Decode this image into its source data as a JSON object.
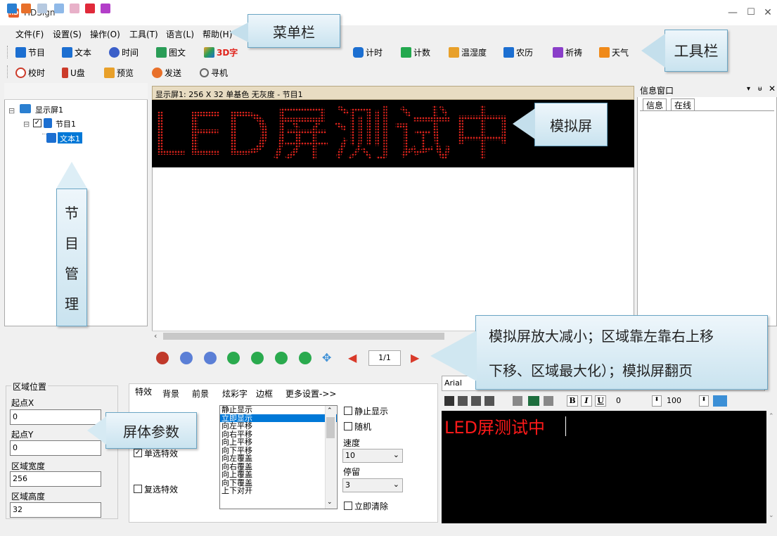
{
  "window": {
    "title": "HDSign",
    "logo_text": "HD"
  },
  "menu": [
    "文件(F)",
    "设置(S)",
    "操作(O)",
    "工具(T)",
    "语言(L)",
    "帮助(H)"
  ],
  "toolbar1": [
    {
      "label": "节目",
      "icon": "program-icon",
      "color": "#1c6fd1"
    },
    {
      "label": "文本",
      "icon": "text-icon",
      "color": "#1c6fd1"
    },
    {
      "label": "时间",
      "icon": "clock-icon",
      "color": "#3b5fc9"
    },
    {
      "label": "图文",
      "icon": "image-icon",
      "color": "#2a9d57"
    },
    {
      "label": "3D字",
      "icon": "cube-icon",
      "color": "#e8a02a"
    },
    {
      "label": "计时",
      "icon": "timer-icon",
      "color": "#1c6fd1"
    },
    {
      "label": "计数",
      "icon": "counter-icon",
      "color": "#23a84e"
    },
    {
      "label": "温湿度",
      "icon": "thermometer-icon",
      "color": "#e8a02a"
    },
    {
      "label": "农历",
      "icon": "calendar-icon",
      "color": "#1c6fd1"
    },
    {
      "label": "祈祷",
      "icon": "prayer-icon",
      "color": "#8a3ec9"
    },
    {
      "label": "天气",
      "icon": "weather-icon",
      "color": "#f08a1a"
    }
  ],
  "toolbar2": [
    {
      "label": "校时",
      "icon": "sync-time-icon",
      "color": "#cc3b2a"
    },
    {
      "label": "U盘",
      "icon": "usb-icon",
      "color": "#cc3b2a"
    },
    {
      "label": "预览",
      "icon": "preview-icon",
      "color": "#e8a02a"
    },
    {
      "label": "发送",
      "icon": "send-icon",
      "color": "#e8702a"
    },
    {
      "label": "寻机",
      "icon": "search-icon",
      "color": "#666"
    }
  ],
  "tree": {
    "screen": "显示屏1",
    "program": "节目1",
    "text": "文本1"
  },
  "screen_header": "显示屏1: 256 X 32  单基色 无灰度 - 节目1",
  "led_text": "LED屏测试中",
  "page_indicator": "1/1",
  "info_panel": {
    "title": "信息窗口",
    "tabs": [
      "信息",
      "在线"
    ]
  },
  "region": {
    "group_title": "区域位置",
    "x_label": "起点X",
    "x_value": "0",
    "y_label": "起点Y",
    "y_value": "0",
    "w_label": "区域宽度",
    "w_value": "256",
    "h_label": "区域高度",
    "h_value": "32"
  },
  "effect_tabs": [
    "特效",
    "背景",
    "前景",
    "炫彩字",
    "边框",
    "更多设置->>"
  ],
  "effect_options": {
    "single": "单选特效",
    "multi": "复选特效"
  },
  "effects": [
    "静止显示",
    "立即显示",
    "向左平移",
    "向右平移",
    "向上平移",
    "向下平移",
    "向左覆盖",
    "向右覆盖",
    "向上覆盖",
    "向下覆盖",
    "上下对开"
  ],
  "effect_selected": 1,
  "right_opts": {
    "still": "静止显示",
    "random": "随机",
    "speed_label": "速度",
    "speed_value": "10",
    "stay_label": "停留",
    "stay_value": "3",
    "clear": "立即清除"
  },
  "editor": {
    "font": "Arial",
    "spacing": "0",
    "scale": "100",
    "text": "LED屏测试中",
    "bold": "B",
    "italic": "I",
    "underline": "U"
  },
  "callouts": {
    "menu": "菜单栏",
    "toolbar": "工具栏",
    "sim_screen": "模拟屏",
    "program_mgmt": [
      "节",
      "目",
      "管",
      "理"
    ],
    "screen_params": "屏体参数",
    "nav_desc_1": "模拟屏放大减小；区域靠左靠右上移",
    "nav_desc_2": "下移、区域最大化）；模拟屏翻页"
  }
}
